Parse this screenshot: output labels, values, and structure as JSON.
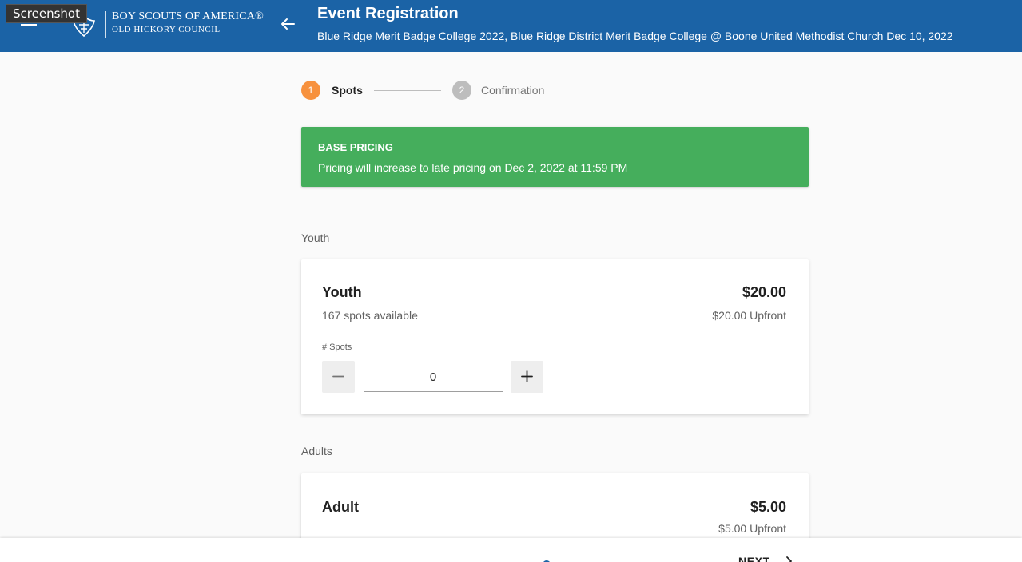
{
  "overlay": {
    "label": "Screenshot"
  },
  "header": {
    "org_name": "BOY SCOUTS OF AMERICA®",
    "council_name": "OLD HICKORY COUNCIL",
    "title": "Event Registration",
    "subtitle": "Blue Ridge Merit Badge College 2022, Blue Ridge District Merit Badge College @ Boone United Methodist Church Dec 10, 2022"
  },
  "stepper": {
    "steps": [
      {
        "number": "1",
        "label": "Spots",
        "state": "active",
        "color": "#f7913d"
      },
      {
        "number": "2",
        "label": "Confirmation",
        "state": "inactive",
        "color": "#bdbdbd"
      }
    ]
  },
  "banner": {
    "title": "BASE PRICING",
    "text": "Pricing will increase to late pricing on Dec 2, 2022 at 11:59 PM",
    "color": "#45ae5c"
  },
  "sections": {
    "youth": {
      "heading": "Youth",
      "card": {
        "name": "Youth",
        "availability": "167 spots available",
        "price": "$20.00",
        "upfront": "$20.00 Upfront",
        "spots_label": "# Spots",
        "quantity": "0"
      }
    },
    "adults": {
      "heading": "Adults",
      "card": {
        "name": "Adult",
        "price": "$5.00",
        "upfront": "$5.00 Upfront"
      }
    }
  },
  "footer": {
    "next_label": "NEXT"
  },
  "colors": {
    "header": "#1b63a6",
    "accent": "#f7913d",
    "success": "#45ae5c"
  },
  "icons": [
    "menu-icon",
    "bsa-logo-icon",
    "back-arrow-icon",
    "minus-icon",
    "plus-icon",
    "chevron-right-icon"
  ]
}
